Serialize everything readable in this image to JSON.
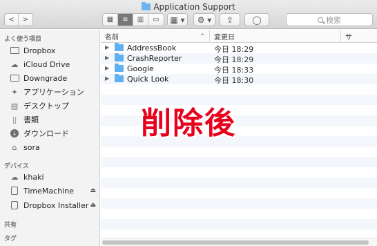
{
  "window": {
    "title": "Application Support"
  },
  "toolbar": {
    "back": "<",
    "forward": ">",
    "view_icon_glyph": "▦",
    "view_list_glyph": "≡",
    "view_column_glyph": "▥",
    "view_cover_glyph": "▭",
    "arrange_glyph": "▦ ▾",
    "action_glyph": "⚙ ▾",
    "share_glyph": "⇪",
    "tag_glyph": "◯",
    "search_placeholder": "検索"
  },
  "sidebar": {
    "favorites_header": "よく使う項目",
    "favorites": [
      {
        "label": "Dropbox",
        "icon": "folder-icon"
      },
      {
        "label": "iCloud Drive",
        "icon": "cloud-icon"
      },
      {
        "label": "Downgrade",
        "icon": "folder-icon"
      },
      {
        "label": "アプリケーション",
        "icon": "applications-icon"
      },
      {
        "label": "デスクトップ",
        "icon": "desktop-icon"
      },
      {
        "label": "書類",
        "icon": "documents-icon"
      },
      {
        "label": "ダウンロード",
        "icon": "downloads-icon"
      },
      {
        "label": "sora",
        "icon": "home-icon"
      }
    ],
    "devices_header": "デバイス",
    "devices": [
      {
        "label": "khaki",
        "icon": "cloud-icon",
        "eject": false
      },
      {
        "label": "TimeMachine",
        "icon": "drive-icon",
        "eject": true
      },
      {
        "label": "Dropbox Installer",
        "icon": "drive-icon",
        "eject": true
      }
    ],
    "shared_header": "共有",
    "tags_header": "タグ",
    "eject_glyph": "⏏"
  },
  "list": {
    "columns": {
      "name": "名前",
      "name_sort": "^",
      "date": "変更日",
      "third": "サ"
    },
    "rows": [
      {
        "name": "AddressBook",
        "date": "今日 18:29"
      },
      {
        "name": "CrashReporter",
        "date": "今日 18:29"
      },
      {
        "name": "Google",
        "date": "今日 18:33"
      },
      {
        "name": "Quick Look",
        "date": "今日 18:30"
      }
    ],
    "disclosure_glyph": "▶"
  },
  "overlay": {
    "text": "削除後",
    "color": "#e8001c"
  },
  "colors": {
    "accent": "#5fb0f0",
    "stripe": "#f3f6fa",
    "sidebar": "#f3f3f3"
  }
}
